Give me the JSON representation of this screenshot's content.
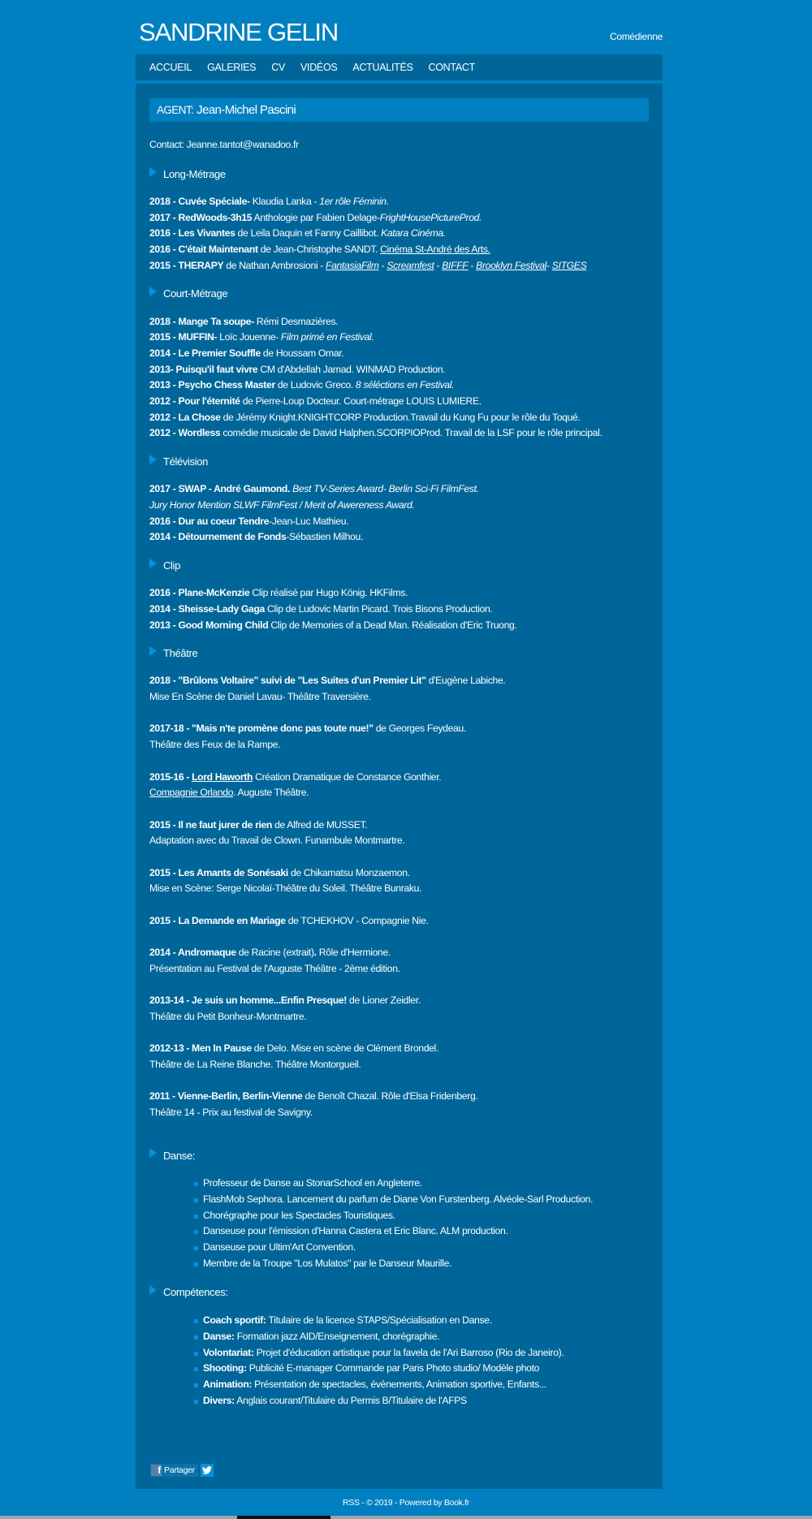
{
  "header": {
    "title": "SANDRINE GELIN",
    "tagline": "Comédienne"
  },
  "nav": [
    "ACCUEIL",
    "GALERIES",
    "CV",
    "VIDÉOS",
    "ACTUALITÉS",
    "CONTACT"
  ],
  "agent": {
    "label": "AGENT:",
    "name": "Jean-Michel Pascini"
  },
  "contact": "Contact: Jeanne.tantot@wanadoo.fr",
  "sections": [
    {
      "title": "Long-Métrage",
      "type": "lines",
      "lines": [
        [
          {
            "t": "2018 - Cuvée Spéciale-",
            "s": "b"
          },
          {
            "t": " Klaudia Lanka - "
          },
          {
            "t": "1er rôle Féminin.",
            "s": "i"
          }
        ],
        [
          {
            "t": "2017 - RedWoods-3h15",
            "s": "b"
          },
          {
            "t": " Anthologie par Fabien Delage-"
          },
          {
            "t": "FrightHousePictureProd.",
            "s": "i"
          }
        ],
        [
          {
            "t": "2016 - Les Vivantes",
            "s": "b"
          },
          {
            "t": " de Leila Daquin et Fanny Caillibot. "
          },
          {
            "t": "Katara Cinéma.",
            "s": "i"
          }
        ],
        [
          {
            "t": "2016 - C'était Maintenant",
            "s": "b"
          },
          {
            "t": " de Jean-Christophe SANDT. "
          },
          {
            "t": "Cinéma St-André des Arts.",
            "s": "u"
          }
        ],
        [
          {
            "t": "2015 - THERAPY",
            "s": "b"
          },
          {
            "t": " de Nathan Ambrosioni - "
          },
          {
            "t": "FantasiaFilm",
            "s": "iu"
          },
          {
            "t": " - "
          },
          {
            "t": "Screamfest",
            "s": "iu"
          },
          {
            "t": " - "
          },
          {
            "t": "BIFFF",
            "s": "iu"
          },
          {
            "t": " - "
          },
          {
            "t": "Brooklyn Festival",
            "s": "iu"
          },
          {
            "t": "- "
          },
          {
            "t": "SITGES",
            "s": "iu"
          }
        ]
      ]
    },
    {
      "title": "Court-Métrage",
      "type": "lines",
      "lines": [
        [
          {
            "t": "2018 - Mange Ta soupe-",
            "s": "b"
          },
          {
            "t": " Rémi Desmazières."
          }
        ],
        [
          {
            "t": "2015 - MUFFIN-",
            "s": "b"
          },
          {
            "t": " Loïc Jouenne- "
          },
          {
            "t": "Film primé en Festival.",
            "s": "i"
          }
        ],
        [
          {
            "t": "2014 - Le Premier Souffle",
            "s": "b"
          },
          {
            "t": " de Houssam Omar."
          }
        ],
        [
          {
            "t": "2013- Puisqu'il faut vivre",
            "s": "b"
          },
          {
            "t": " CM d'Abdellah Jamad. WINMAD Production."
          }
        ],
        [
          {
            "t": "2013 - Psycho Chess Master",
            "s": "b"
          },
          {
            "t": " de Ludovic Greco. "
          },
          {
            "t": "8 séléctions en Festival.",
            "s": "i"
          }
        ],
        [
          {
            "t": "2012 - Pour l'éternité",
            "s": "b"
          },
          {
            "t": " de Pierre-Loup Docteur. Court-métrage LOUIS LUMIERE."
          }
        ],
        [
          {
            "t": "2012 - La Chose",
            "s": "b"
          },
          {
            "t": " de Jérémy Knight.KNIGHTCORP Production.Travail du Kung Fu pour le rôle du Toqué."
          }
        ],
        [
          {
            "t": "2012 - Wordless",
            "s": "b"
          },
          {
            "t": " comédie musicale de David Halphen.SCORPIOProd. Travail de la LSF pour le rôle principal."
          }
        ]
      ]
    },
    {
      "title": "Télévision",
      "type": "lines",
      "lines": [
        [
          {
            "t": "2017 - SWAP - André Gaumond.",
            "s": "b"
          },
          {
            "t": " Best TV-Series Award- Berlin Sci-Fi FilmFest.",
            "s": "i"
          }
        ],
        [
          {
            "t": "Jury Honor Mention SLWF FilmFest / Merit of Awereness Award.",
            "s": "i"
          }
        ],
        [
          {
            "t": "2016 - Dur au coeur Tendre",
            "s": "b"
          },
          {
            "t": "-Jean-Luc Mathieu."
          }
        ],
        [
          {
            "t": "2014 - Détournement de Fonds",
            "s": "b"
          },
          {
            "t": "-Sébastien Milhou."
          }
        ]
      ]
    },
    {
      "title": "Clip",
      "type": "lines",
      "lines": [
        [
          {
            "t": "2016 - Plane-McKenzie",
            "s": "b"
          },
          {
            "t": " Clip réalisé par Hugo König. HKFilms."
          }
        ],
        [
          {
            "t": "2014 - Sheisse-Lady Gaga",
            "s": "b"
          },
          {
            "t": " Clip de Ludovic Martin Picard. Trois Bisons Production."
          }
        ],
        [
          {
            "t": "2013 - Good Morning Child",
            "s": "b"
          },
          {
            "t": " Clip de Memories of a Dead Man. Réalisation d'Eric Truong."
          }
        ]
      ]
    },
    {
      "title": "Théâtre",
      "type": "groups",
      "groups": [
        [
          [
            {
              "t": "2018 - \"Brûlons Voltaire\" suivi de \"Les Suites d'un Premier Lit\"",
              "s": "b"
            },
            {
              "t": " d'Eugène Labiche."
            }
          ],
          [
            {
              "t": "Mise En Scène de Daniel Lavau- Théâtre Traversière."
            }
          ]
        ],
        [
          [
            {
              "t": "2017-18 - \"Mais n'te promène donc pas toute nue!\"",
              "s": "b"
            },
            {
              "t": " de Georges Feydeau."
            }
          ],
          [
            {
              "t": "Théâtre des Feux de la Rampe."
            }
          ]
        ],
        [
          [
            {
              "t": "2015-16 - ",
              "s": "b"
            },
            {
              "t": "Lord Haworth",
              "s": "bu"
            },
            {
              "t": " Création Dramatique de Constance Gonthier."
            }
          ],
          [
            {
              "t": "Compagnie Orlando",
              "s": "u"
            },
            {
              "t": ". Auguste Théâtre."
            }
          ]
        ],
        [
          [
            {
              "t": "2015 - Il ne faut jurer de rien",
              "s": "b"
            },
            {
              "t": " de Alfred de MUSSET."
            }
          ],
          [
            {
              "t": "Adaptation avec du Travail de Clown. Funambule Montmartre."
            }
          ]
        ],
        [
          [
            {
              "t": "2015 - Les Amants de Sonésaki",
              "s": "b"
            },
            {
              "t": " de Chikamatsu Monzaemon."
            }
          ],
          [
            {
              "t": "Mise en Scène: Serge Nicolaï-Théâtre du Soleil. Théâtre Bunraku."
            }
          ]
        ],
        [
          [
            {
              "t": "2015 - La Demande en Mariage",
              "s": "b"
            },
            {
              "t": " de TCHEKHOV - Compagnie Nie."
            }
          ]
        ],
        [
          [
            {
              "t": "2014 - Andromaque",
              "s": "b"
            },
            {
              "t": " de Racine (extrait)"
            },
            {
              "t": ".",
              "s": "b"
            },
            {
              "t": " Rôle d'Hermione."
            }
          ],
          [
            {
              "t": "Présentation au Festival de l'Auguste Théâtre - 2ème édition."
            }
          ]
        ],
        [
          [
            {
              "t": "2013-14 - Je suis un homme...Enfin Presque!",
              "s": "b"
            },
            {
              "t": " de Lioner Zeidler."
            }
          ],
          [
            {
              "t": "Théâtre du Petit Bonheur-Montmartre."
            }
          ]
        ],
        [
          [
            {
              "t": "2012-13 - Men In Pause",
              "s": "b"
            },
            {
              "t": " de Delo. Mise en scène de Clément Brondel."
            }
          ],
          [
            {
              "t": "Théâtre de La Reine Blanche. Théâtre Montorgueil."
            }
          ]
        ],
        [
          [
            {
              "t": "2011 - Vienne-Berlin, Berlin-Vienne",
              "s": "b"
            },
            {
              "t": " de Benoît Chazal. Rôle d'Elsa Fridenberg."
            }
          ],
          [
            {
              "t": "Théâtre 14 - Prix au festival de Savigny."
            }
          ]
        ]
      ]
    },
    {
      "title": "Danse:",
      "type": "list",
      "lines": [
        [
          {
            "t": "Professeur de Danse au StonarSchool en Angleterre."
          }
        ],
        [
          {
            "t": "FlashMob Sephora. Lancement du parfum de Diane Von Furstenberg. Alvéole-Sarl Production."
          }
        ],
        [
          {
            "t": "Chorégraphe pour les Spectacles Touristiques."
          }
        ],
        [
          {
            "t": "Danseuse pour l'émission d'Hanna Castera et Eric Blanc. ALM production."
          }
        ],
        [
          {
            "t": "Danseuse pour Ultim'Art Convention."
          }
        ],
        [
          {
            "t": "Membre de la Troupe \"Los Mulatos\" par le Danseur Maurille."
          }
        ]
      ]
    },
    {
      "title": "Compétences:",
      "type": "list",
      "lines": [
        [
          {
            "t": "Coach sportif:",
            "s": "b"
          },
          {
            "t": " Titulaire de la licence STAPS/Spécialisation en Danse."
          }
        ],
        [
          {
            "t": "Danse:",
            "s": "b"
          },
          {
            "t": " Formation jazz AID/Enseignement, chorégraphie."
          }
        ],
        [
          {
            "t": "Volontariat:",
            "s": "b"
          },
          {
            "t": " Projet d'éducation artistique pour la favela de l'Ari Barroso (Rio de Janeiro)."
          }
        ],
        [
          {
            "t": "Shooting:",
            "s": "b"
          },
          {
            "t": " Publicité E-manager Commande par Paris Photo studio/ Modèle photo"
          }
        ],
        [
          {
            "t": "Animation:",
            "s": "b"
          },
          {
            "t": " Présentation de spectacles, évènements, Animation sportive, Enfants..."
          }
        ],
        [
          {
            "t": "Divers:",
            "s": "b"
          },
          {
            "t": " Anglais courant/Titulaire du Permis B/Titulaire de l'AFPS"
          }
        ]
      ]
    }
  ],
  "share": {
    "facebook_label": "Partager",
    "facebook_icon": "facebook-icon",
    "twitter_icon": "twitter-icon"
  },
  "footer": "RSS - © 2019 - Powered by Book.fr",
  "colors": {
    "background": "#0080c0",
    "panel": "#006699",
    "accent": "#0a8fd8"
  }
}
